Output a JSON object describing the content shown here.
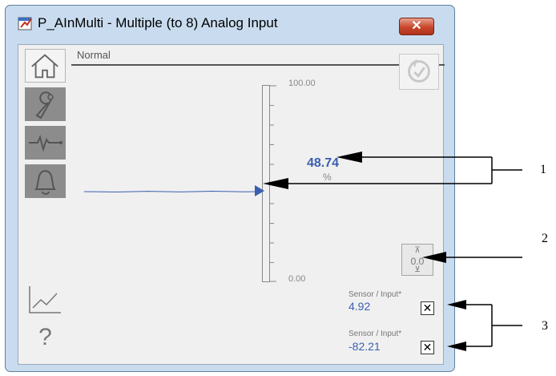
{
  "window": {
    "title": "P_AInMulti - Multiple (to 8) Analog Input",
    "close_label": "✕"
  },
  "sidebar": {
    "items": [
      {
        "name": "home-icon",
        "state": "active"
      },
      {
        "name": "wrench-icon",
        "state": "inactive"
      },
      {
        "name": "waveform-icon",
        "state": "inactive"
      },
      {
        "name": "bell-icon",
        "state": "inactive"
      }
    ],
    "bottom": [
      {
        "name": "trend-chart-icon"
      },
      {
        "name": "help-icon",
        "label": "?"
      }
    ]
  },
  "main": {
    "mode": "Normal",
    "bar": {
      "max_label": "100.00",
      "min_label": "0.00"
    },
    "pv": {
      "value": "48.74",
      "unit": "%"
    },
    "reset": {
      "label": "0.0"
    },
    "sensors": [
      {
        "label": "Sensor / Input*",
        "value": "4.92",
        "check": "✕"
      },
      {
        "label": "Sensor / Input*",
        "value": "-82.21",
        "check": "✕"
      }
    ]
  },
  "callouts": [
    "1",
    "2",
    "3"
  ],
  "colors": {
    "accent": "#3a5fb0",
    "frame": "#c9dcef",
    "close": "#c7462c",
    "nav_inactive": "#8c8c8c"
  }
}
